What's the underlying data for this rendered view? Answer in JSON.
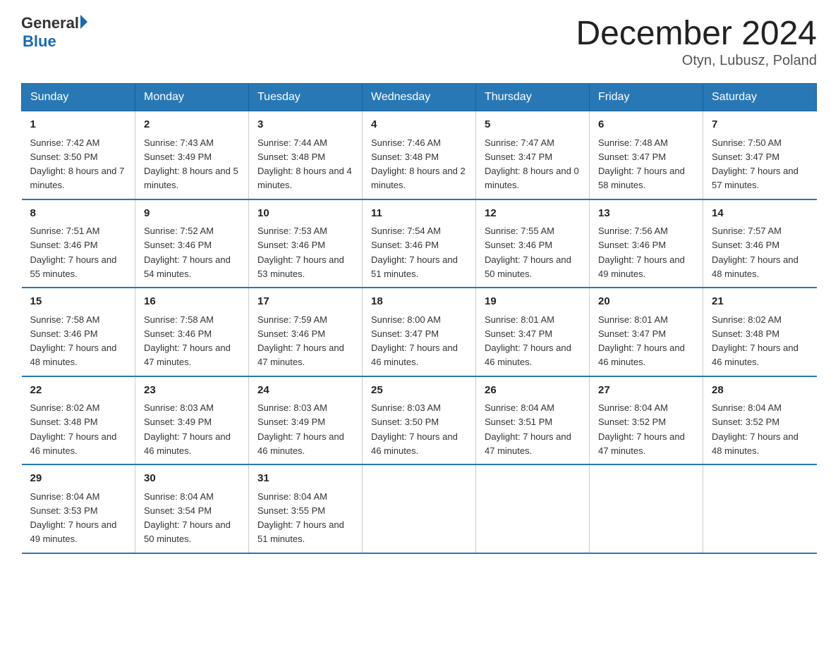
{
  "header": {
    "logo_general": "General",
    "logo_blue": "Blue",
    "title": "December 2024",
    "location": "Otyn, Lubusz, Poland"
  },
  "days_of_week": [
    "Sunday",
    "Monday",
    "Tuesday",
    "Wednesday",
    "Thursday",
    "Friday",
    "Saturday"
  ],
  "weeks": [
    [
      {
        "day": "1",
        "sunrise": "7:42 AM",
        "sunset": "3:50 PM",
        "daylight": "8 hours and 7 minutes."
      },
      {
        "day": "2",
        "sunrise": "7:43 AM",
        "sunset": "3:49 PM",
        "daylight": "8 hours and 5 minutes."
      },
      {
        "day": "3",
        "sunrise": "7:44 AM",
        "sunset": "3:48 PM",
        "daylight": "8 hours and 4 minutes."
      },
      {
        "day": "4",
        "sunrise": "7:46 AM",
        "sunset": "3:48 PM",
        "daylight": "8 hours and 2 minutes."
      },
      {
        "day": "5",
        "sunrise": "7:47 AM",
        "sunset": "3:47 PM",
        "daylight": "8 hours and 0 minutes."
      },
      {
        "day": "6",
        "sunrise": "7:48 AM",
        "sunset": "3:47 PM",
        "daylight": "7 hours and 58 minutes."
      },
      {
        "day": "7",
        "sunrise": "7:50 AM",
        "sunset": "3:47 PM",
        "daylight": "7 hours and 57 minutes."
      }
    ],
    [
      {
        "day": "8",
        "sunrise": "7:51 AM",
        "sunset": "3:46 PM",
        "daylight": "7 hours and 55 minutes."
      },
      {
        "day": "9",
        "sunrise": "7:52 AM",
        "sunset": "3:46 PM",
        "daylight": "7 hours and 54 minutes."
      },
      {
        "day": "10",
        "sunrise": "7:53 AM",
        "sunset": "3:46 PM",
        "daylight": "7 hours and 53 minutes."
      },
      {
        "day": "11",
        "sunrise": "7:54 AM",
        "sunset": "3:46 PM",
        "daylight": "7 hours and 51 minutes."
      },
      {
        "day": "12",
        "sunrise": "7:55 AM",
        "sunset": "3:46 PM",
        "daylight": "7 hours and 50 minutes."
      },
      {
        "day": "13",
        "sunrise": "7:56 AM",
        "sunset": "3:46 PM",
        "daylight": "7 hours and 49 minutes."
      },
      {
        "day": "14",
        "sunrise": "7:57 AM",
        "sunset": "3:46 PM",
        "daylight": "7 hours and 48 minutes."
      }
    ],
    [
      {
        "day": "15",
        "sunrise": "7:58 AM",
        "sunset": "3:46 PM",
        "daylight": "7 hours and 48 minutes."
      },
      {
        "day": "16",
        "sunrise": "7:58 AM",
        "sunset": "3:46 PM",
        "daylight": "7 hours and 47 minutes."
      },
      {
        "day": "17",
        "sunrise": "7:59 AM",
        "sunset": "3:46 PM",
        "daylight": "7 hours and 47 minutes."
      },
      {
        "day": "18",
        "sunrise": "8:00 AM",
        "sunset": "3:47 PM",
        "daylight": "7 hours and 46 minutes."
      },
      {
        "day": "19",
        "sunrise": "8:01 AM",
        "sunset": "3:47 PM",
        "daylight": "7 hours and 46 minutes."
      },
      {
        "day": "20",
        "sunrise": "8:01 AM",
        "sunset": "3:47 PM",
        "daylight": "7 hours and 46 minutes."
      },
      {
        "day": "21",
        "sunrise": "8:02 AM",
        "sunset": "3:48 PM",
        "daylight": "7 hours and 46 minutes."
      }
    ],
    [
      {
        "day": "22",
        "sunrise": "8:02 AM",
        "sunset": "3:48 PM",
        "daylight": "7 hours and 46 minutes."
      },
      {
        "day": "23",
        "sunrise": "8:03 AM",
        "sunset": "3:49 PM",
        "daylight": "7 hours and 46 minutes."
      },
      {
        "day": "24",
        "sunrise": "8:03 AM",
        "sunset": "3:49 PM",
        "daylight": "7 hours and 46 minutes."
      },
      {
        "day": "25",
        "sunrise": "8:03 AM",
        "sunset": "3:50 PM",
        "daylight": "7 hours and 46 minutes."
      },
      {
        "day": "26",
        "sunrise": "8:04 AM",
        "sunset": "3:51 PM",
        "daylight": "7 hours and 47 minutes."
      },
      {
        "day": "27",
        "sunrise": "8:04 AM",
        "sunset": "3:52 PM",
        "daylight": "7 hours and 47 minutes."
      },
      {
        "day": "28",
        "sunrise": "8:04 AM",
        "sunset": "3:52 PM",
        "daylight": "7 hours and 48 minutes."
      }
    ],
    [
      {
        "day": "29",
        "sunrise": "8:04 AM",
        "sunset": "3:53 PM",
        "daylight": "7 hours and 49 minutes."
      },
      {
        "day": "30",
        "sunrise": "8:04 AM",
        "sunset": "3:54 PM",
        "daylight": "7 hours and 50 minutes."
      },
      {
        "day": "31",
        "sunrise": "8:04 AM",
        "sunset": "3:55 PM",
        "daylight": "7 hours and 51 minutes."
      },
      null,
      null,
      null,
      null
    ]
  ]
}
